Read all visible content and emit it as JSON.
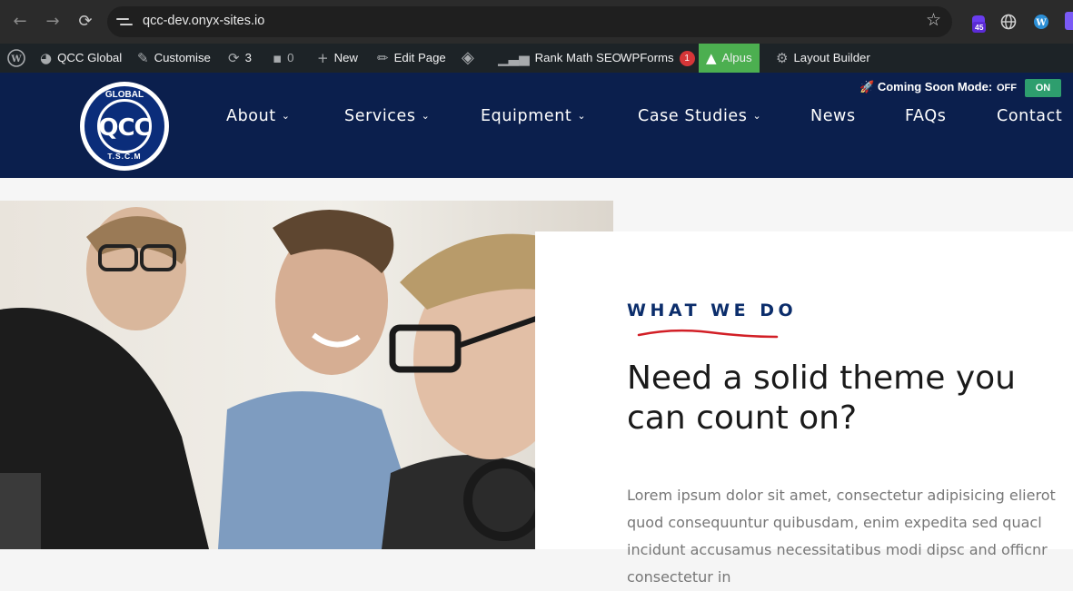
{
  "browser": {
    "url": "qcc-dev.onyx-sites.io",
    "extension_badge": "45",
    "icons": [
      "back-icon",
      "forward-icon",
      "reload-icon",
      "site-settings-icon",
      "star-icon",
      "extension-icon",
      "globe-icon",
      "wordpress-icon"
    ]
  },
  "adminbar": {
    "site_name": "QCC Global",
    "customise": "Customise",
    "updates_count": "3",
    "comments_count": "0",
    "new_label": "New",
    "edit_page": "Edit Page",
    "rank_math": "Rank Math SEO",
    "wpforms": "WPForms",
    "wpforms_count": "1",
    "alpus": "Alpus",
    "layout_builder": "Layout Builder"
  },
  "header": {
    "logo": {
      "top": "GLOBAL",
      "center": "QCC",
      "bottom": "T.S.C.M"
    },
    "coming_soon_label": "Coming Soon Mode:",
    "toggle_off": "OFF",
    "toggle_on": "ON",
    "menu": [
      {
        "label": "About",
        "has_dropdown": true
      },
      {
        "label": "Services",
        "has_dropdown": true
      },
      {
        "label": "Equipment",
        "has_dropdown": true
      },
      {
        "label": "Case Studies",
        "has_dropdown": true
      },
      {
        "label": "News",
        "has_dropdown": false
      },
      {
        "label": "FAQs",
        "has_dropdown": false
      },
      {
        "label": "Contact",
        "has_dropdown": false
      }
    ]
  },
  "section": {
    "eyebrow": "WHAT WE DO",
    "heading": "Need a solid theme you can count on?",
    "body": "Lorem ipsum dolor sit amet, consectetur adipisicing elierot quod consequuntur quibusdam, enim expedita sed quacl incidunt accusamus necessitatibus modi dipsc and officnr consectetur in"
  },
  "colors": {
    "header_bg": "#0b1f4d",
    "accent_blue": "#0b2d6b",
    "accent_red": "#d21f26",
    "toggle_on": "#2e9e6e",
    "alpus_green": "#4caf50",
    "wp_bubble": "#d63638"
  }
}
